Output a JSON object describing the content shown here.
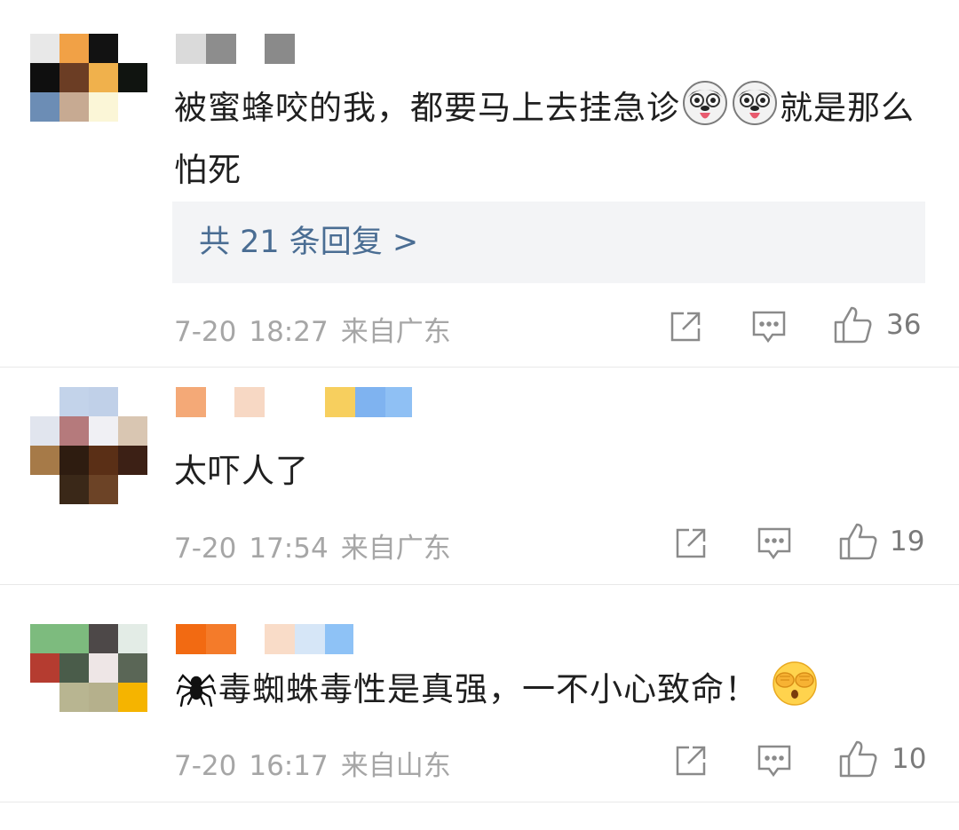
{
  "colors": {
    "link": "#4a6d93",
    "meta": "#a6a6a6",
    "divider": "#e9e9e9",
    "reply_bg": "#f3f4f6"
  },
  "comments": [
    {
      "text_before": "被蜜蜂咬的我，都要马上去挂急诊",
      "emojis_mid": [
        "husky-emoji",
        "husky-emoji"
      ],
      "text_after": "就是那么怕死",
      "replies_label": "共 21 条回复 >",
      "date": "7-20",
      "time": "18:27",
      "location": "来自广东",
      "likes": "36"
    },
    {
      "text": "太吓人了",
      "date": "7-20",
      "time": "17:54",
      "location": "来自广东",
      "likes": "19"
    },
    {
      "emoji_before": "spider-emoji",
      "text": "毒蜘蛛毒性是真强，一不小心致命！",
      "emoji_after": "covering-eyes-emoji",
      "date": "7-20",
      "time": "16:17",
      "location": "来自山东",
      "likes": "10"
    }
  ]
}
